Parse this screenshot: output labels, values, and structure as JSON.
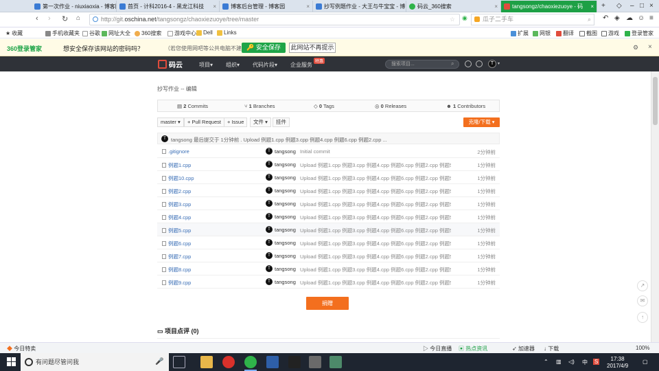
{
  "browser": {
    "tabs": [
      {
        "title": "第一次作业 - niuxiaoxia - 博客园",
        "active": false
      },
      {
        "title": "首页 - 计科2016-4 - 黑龙江科技",
        "active": false
      },
      {
        "title": "博客后台管理 - 博客园",
        "active": false
      },
      {
        "title": "抄写例题作业 - 大王与牛宝宝 - 博",
        "active": false
      },
      {
        "title": "码云_360搜索",
        "active": false
      },
      {
        "title": "tangsongz/chaoxiezuoye - 码",
        "active": true
      }
    ],
    "url_prefix": "http://git.",
    "url_domain": "oschina.net",
    "url_path": "/tangsongz/chaoxiezuoye/tree/master",
    "search_placeholder": "瓜子二手车",
    "bookmarks": [
      "收藏",
      "手机收藏夹",
      "谷歌",
      "网址大全",
      "360搜索",
      "游戏中心",
      "Dell",
      "Links"
    ],
    "right_tools": [
      "扩展",
      "网银",
      "翻译",
      "截图",
      "游戏",
      "登录管家"
    ]
  },
  "password_bar": {
    "brand": "360登录管家",
    "question": "想安全保存该网站的密码吗？",
    "note": "（若您使用网吧等公共电脑不建议保存）",
    "save_label": "安全保存",
    "never_label": "此网站不再提示"
  },
  "site": {
    "brand": "码云",
    "nav": [
      "项目▾",
      "组织▾",
      "代码片段▾",
      "企业服务"
    ],
    "hot_badge": "特惠",
    "search_placeholder": "搜索项目...",
    "avatar_letter": "T"
  },
  "repo": {
    "breadcrumb": "抄写作业 -- 编辑",
    "stats": {
      "commits": "2",
      "commits_label": "Commits",
      "branches": "1",
      "branches_label": "Branches",
      "tags": "0",
      "tags_label": "Tags",
      "releases": "0",
      "releases_label": "Releases",
      "contributors": "1",
      "contributors_label": "Contributors"
    },
    "toolbar": {
      "branch": "master ▾",
      "pull_request": "+ Pull Request",
      "issue": "+ Issue",
      "file": "文件 ▾",
      "wiki": "挂件",
      "download": "克隆/下载 ▾"
    },
    "last_commit": "tangsong 最后提交于 1分钟前 . Upload 例题1.cpp 例题3.cpp 例题4.cpp 例题6.cpp 例题2.cpp ...",
    "files": [
      {
        "name": ".gitignore",
        "author": "tangsong",
        "message": "Initial commit",
        "time": "2分钟前"
      },
      {
        "name": "例题1.cpp",
        "author": "tangsong",
        "message": "Upload 例题1.cpp 例题3.cpp 例题4.cpp 例题6.cpp 例题2.cpp 例题5.c...",
        "time": "1分钟前"
      },
      {
        "name": "例题10.cpp",
        "author": "tangsong",
        "message": "Upload 例题1.cpp 例题3.cpp 例题4.cpp 例题6.cpp 例题2.cpp 例题5.c...",
        "time": "1分钟前"
      },
      {
        "name": "例题2.cpp",
        "author": "tangsong",
        "message": "Upload 例题1.cpp 例题3.cpp 例题4.cpp 例题6.cpp 例题2.cpp 例题5.c...",
        "time": "1分钟前"
      },
      {
        "name": "例题3.cpp",
        "author": "tangsong",
        "message": "Upload 例题1.cpp 例题3.cpp 例题4.cpp 例题6.cpp 例题2.cpp 例题5.c...",
        "time": "1分钟前"
      },
      {
        "name": "例题4.cpp",
        "author": "tangsong",
        "message": "Upload 例题1.cpp 例题3.cpp 例题4.cpp 例题6.cpp 例题2.cpp 例题5.c...",
        "time": "1分钟前"
      },
      {
        "name": "例题5.cpp",
        "author": "tangsong",
        "message": "Upload 例题1.cpp 例题3.cpp 例题4.cpp 例题6.cpp 例题2.cpp 例题5.c...",
        "time": "1分钟前"
      },
      {
        "name": "例题6.cpp",
        "author": "tangsong",
        "message": "Upload 例题1.cpp 例题3.cpp 例题4.cpp 例题6.cpp 例题2.cpp 例题5.c...",
        "time": "1分钟前"
      },
      {
        "name": "例题7.cpp",
        "author": "tangsong",
        "message": "Upload 例题1.cpp 例题3.cpp 例题4.cpp 例题6.cpp 例题2.cpp 例题5.c...",
        "time": "1分钟前"
      },
      {
        "name": "例题8.cpp",
        "author": "tangsong",
        "message": "Upload 例题1.cpp 例题3.cpp 例题4.cpp 例题6.cpp 例题2.cpp 例题5.c...",
        "time": "1分钟前"
      },
      {
        "name": "例题9.cpp",
        "author": "tangsong",
        "message": "Upload 例题1.cpp 例题3.cpp 例题4.cpp 例题6.cpp 例题2.cpp 例题5.c...",
        "time": "1分钟前"
      }
    ],
    "prev_label": "捐赠",
    "review_title": "项目点评 (0)"
  },
  "statusbar": {
    "left": "今日特卖",
    "items": [
      "今日直播",
      "热点资讯",
      "加速器",
      "下载"
    ],
    "zoom": "100%"
  },
  "taskbar": {
    "search_placeholder": "有问题尽管问我",
    "time": "17:38",
    "date": "2017/4/9",
    "ime": "中"
  },
  "colors": {
    "accent_orange": "#f36f1e",
    "tab_active": "#1da045",
    "header_dark": "#2f3238",
    "link_blue": "#3b6fb6"
  }
}
